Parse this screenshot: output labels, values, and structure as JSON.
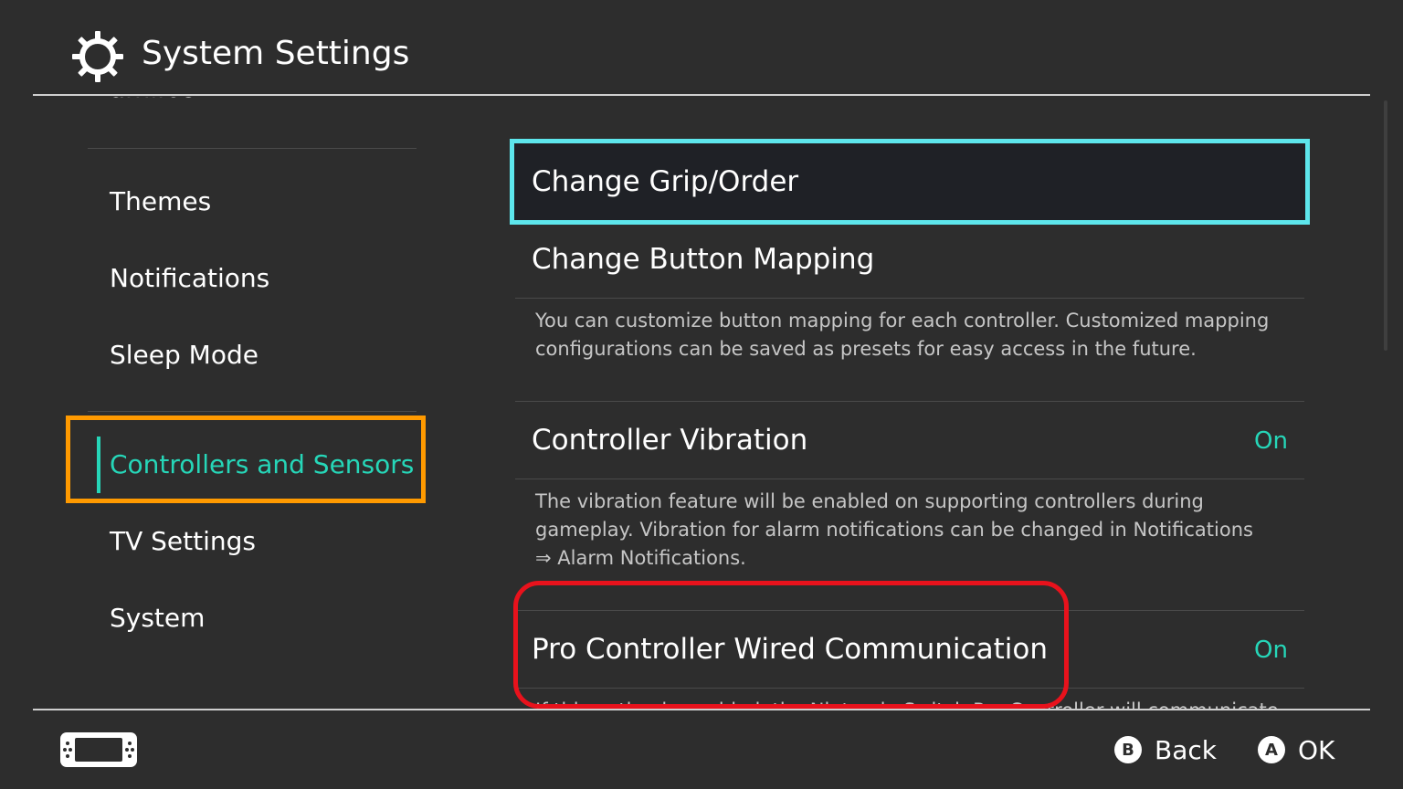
{
  "header": {
    "title": "System Settings",
    "icon": "gear-icon"
  },
  "sidebar": {
    "partial_item": "amiibo",
    "items": [
      {
        "label": "Themes"
      },
      {
        "label": "Notifications"
      },
      {
        "label": "Sleep Mode"
      },
      {
        "label": "Controllers and Sensors",
        "active": true
      },
      {
        "label": "TV Settings"
      },
      {
        "label": "System"
      }
    ]
  },
  "content": {
    "rows": [
      {
        "title": "Change Grip/Order",
        "focused": true
      },
      {
        "title": "Change Button Mapping",
        "description": "You can customize button mapping for each controller. Customized mapping configurations can be saved as presets for easy access in the future."
      },
      {
        "title": "Controller Vibration",
        "value": "On",
        "description": "The vibration feature will be enabled on supporting controllers during gameplay. Vibration for alarm notifications can be changed in Notifications ⇒ Alarm Notifications."
      },
      {
        "title": "Pro Controller Wired Communication",
        "value": "On",
        "description_partial": "If this option is enabled, the Nintendo Switch Pro Controller will communicate"
      }
    ]
  },
  "footer": {
    "console_icon": "handheld-console-icon",
    "back": {
      "button": "B",
      "label": "Back"
    },
    "ok": {
      "button": "A",
      "label": "OK"
    }
  },
  "colors": {
    "background": "#2d2d2d",
    "accent": "#26d6b8",
    "focus_border": "#5de6ec",
    "orange_highlight": "#ff9a00",
    "red_highlight": "#e8121c"
  }
}
